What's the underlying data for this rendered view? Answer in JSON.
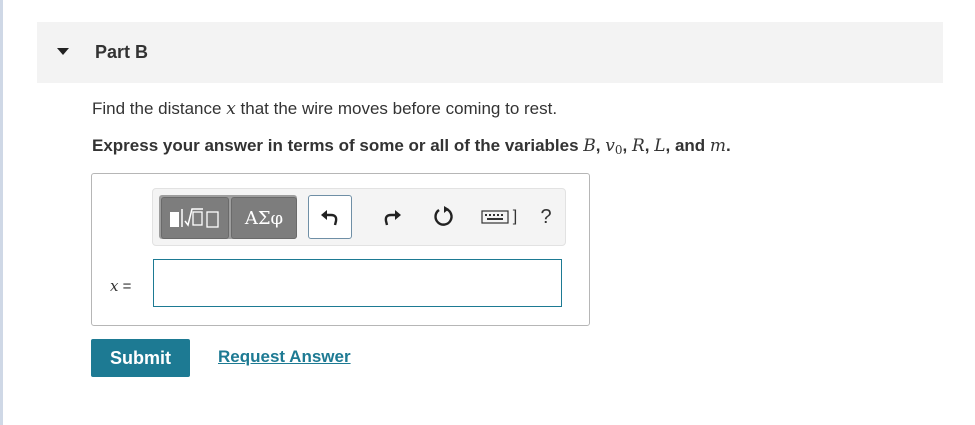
{
  "part": {
    "title": "Part B"
  },
  "question": {
    "prompt_before": "Find the distance ",
    "prompt_var": "x",
    "prompt_after": " that the wire moves before coming to rest.",
    "instruction_prefix": "Express your answer in terms of some or all of the variables ",
    "var_B": "B",
    "var_v": "v",
    "var_v_sub": "0",
    "var_R": "R",
    "var_L": "L",
    "var_m": "m",
    "sep1": ", ",
    "sep2": ", ",
    "sep3": ", ",
    "sep_and": ", and ",
    "end": "."
  },
  "toolbar": {
    "greek_label": "ΑΣφ",
    "help_label": "?",
    "keyboard_suffix": "]"
  },
  "answer": {
    "variable_label": "x",
    "equals": " =",
    "value": ""
  },
  "actions": {
    "submit_label": "Submit",
    "request_label": "Request Answer"
  },
  "colors": {
    "accent": "#1d7a93",
    "header_bg": "#f3f3f3",
    "toolbar_dark": "#7d7d7d"
  }
}
